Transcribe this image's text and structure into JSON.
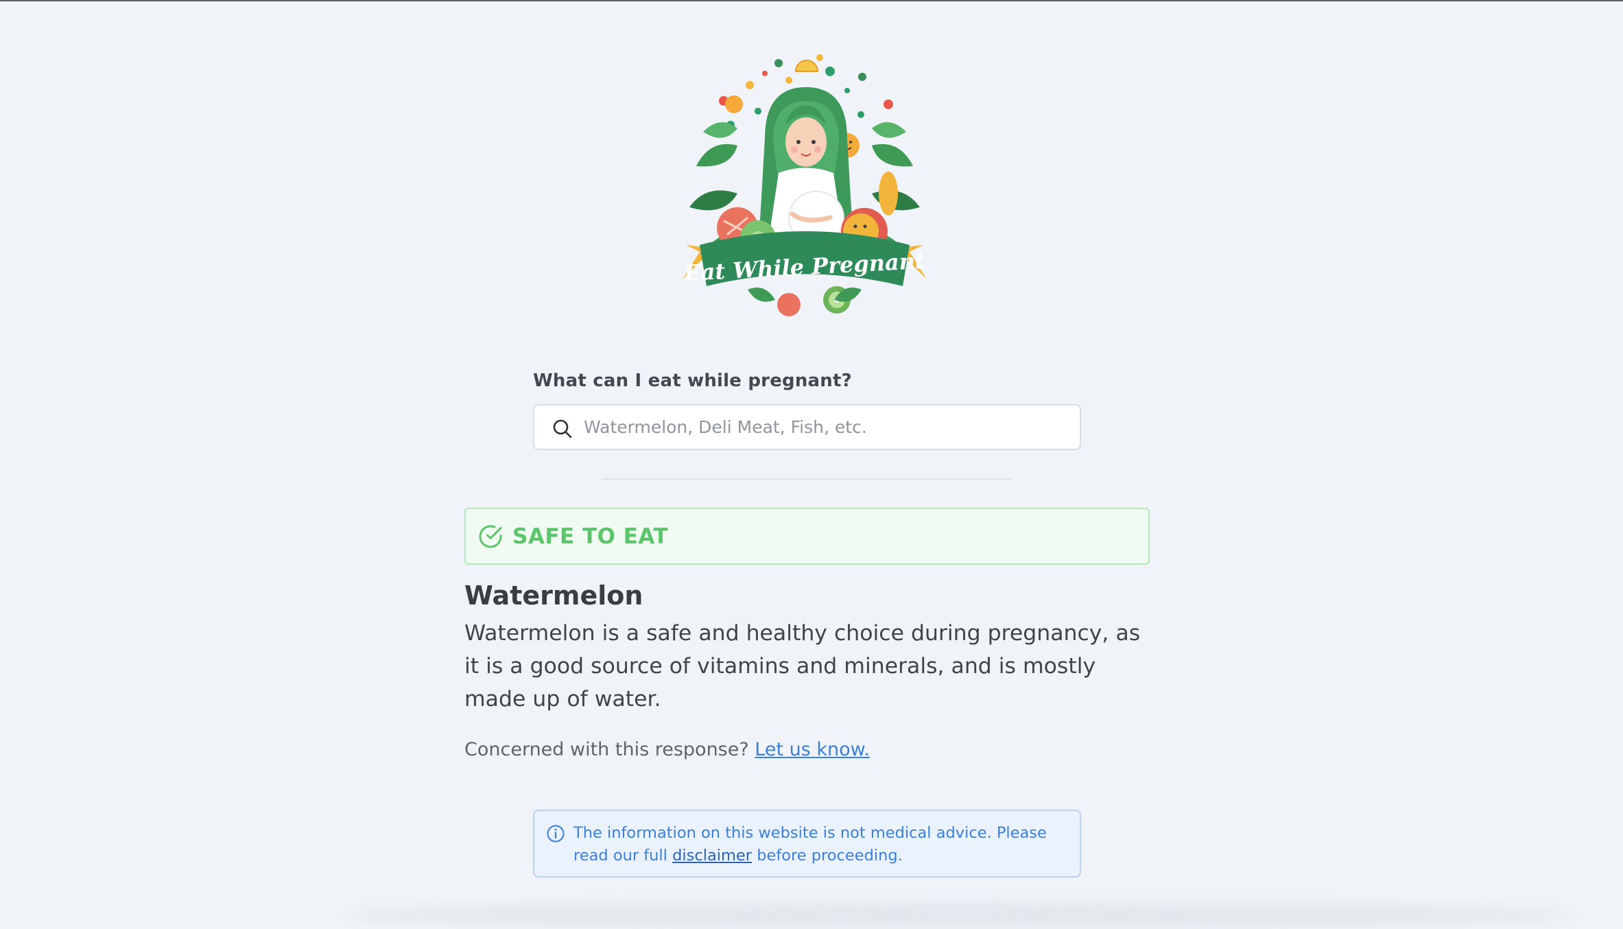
{
  "logo": {
    "alt": "Eat While Pregnant logo",
    "banner_text": "Eat While Pregnant"
  },
  "search": {
    "label": "What can I eat while pregnant?",
    "placeholder": "Watermelon, Deli Meat, Fish, etc.",
    "value": ""
  },
  "result": {
    "status_label": "SAFE TO EAT",
    "status_color": "#5cc56b",
    "food_name": "Watermelon",
    "description": "Watermelon is a safe and healthy choice during pregnancy, as it is a good source of vitamins and minerals, and is mostly made up of water."
  },
  "feedback": {
    "prompt": "Concerned with this response?",
    "link_text": "Let us know."
  },
  "notice": {
    "text_before": "The information on this website is not medical advice. Please read our full",
    "link_text": "disclaimer",
    "text_after": "before proceeding."
  }
}
